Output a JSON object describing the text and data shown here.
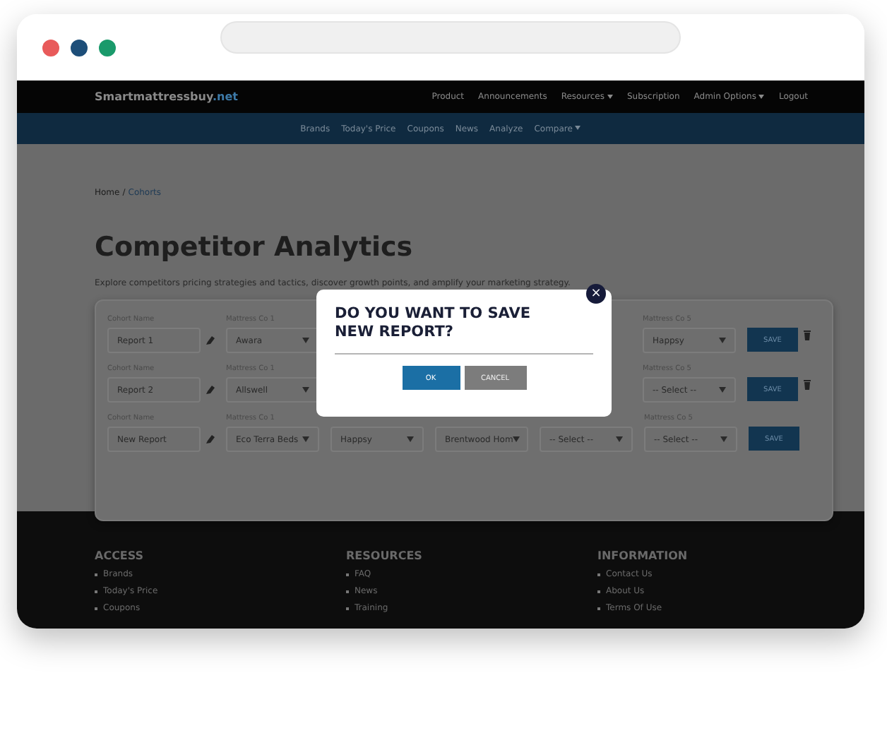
{
  "browser": {
    "dots": [
      {
        "color": "#e85a5a"
      },
      {
        "color": "#1d4e79"
      },
      {
        "color": "#1a9a6b"
      }
    ]
  },
  "site": {
    "logo": "Smartmattressbuy",
    "logo_suffix": ".net",
    "nav": [
      {
        "label": "Product",
        "dropdown": false
      },
      {
        "label": "Announcements",
        "dropdown": false
      },
      {
        "label": "Resources",
        "dropdown": true
      },
      {
        "label": "Subscription",
        "dropdown": false
      },
      {
        "label": "Admin Options",
        "dropdown": true
      },
      {
        "label": "Logout",
        "dropdown": false
      }
    ],
    "subnav": [
      {
        "label": "Brands",
        "dropdown": false
      },
      {
        "label": "Today's Price",
        "dropdown": false
      },
      {
        "label": "Coupons",
        "dropdown": false
      },
      {
        "label": "News",
        "dropdown": false
      },
      {
        "label": "Analyze",
        "dropdown": false
      },
      {
        "label": "Compare",
        "dropdown": true
      }
    ]
  },
  "breadcrumb": {
    "home": "Home",
    "separator": "/",
    "current": "Cohorts"
  },
  "title": "Competitor Analytics",
  "subtitle": "Explore competitors pricing strategies and tactics, discover growth points, and amplify your marketing strategy.",
  "rows": [
    {
      "cohort_label": "Cohort Name",
      "cohort_name": "Report 1",
      "first_label": "Mattress Co 1",
      "first_value": "Awara",
      "last_label": "Mattress Co 5",
      "last_value": "Happsy",
      "button": "SAVE",
      "deletable": true
    },
    {
      "cohort_label": "Cohort Name",
      "cohort_name": "Report 2",
      "first_label": "Mattress Co 1",
      "first_value": "Allswell",
      "last_label": "Mattress Co 5",
      "last_value": "-- Select --",
      "button": "SAVE",
      "deletable": true
    },
    {
      "cohort_label": "Cohort Name",
      "cohort_name": "New Report",
      "first_label": "Mattress Co 1",
      "first_value": "Eco Terra Beds",
      "middle_values": [
        "Happsy",
        "Brentwood Hom",
        "-- Select --"
      ],
      "last_label": "Mattress Co 5",
      "last_value": "-- Select --",
      "button": "SAVE",
      "deletable": false
    }
  ],
  "footer": [
    {
      "heading": "ACCESS",
      "items": [
        "Brands",
        "Today's Price",
        "Coupons"
      ]
    },
    {
      "heading": "RESOURCES",
      "items": [
        "FAQ",
        "News",
        "Training"
      ]
    },
    {
      "heading": "INFORMATION",
      "items": [
        "Contact Us",
        "About Us",
        "Terms Of Use"
      ]
    }
  ],
  "modal": {
    "title": "DO YOU WANT TO SAVE NEW REPORT?",
    "close": "×",
    "ok": "OK",
    "cancel": "CANCEL"
  }
}
